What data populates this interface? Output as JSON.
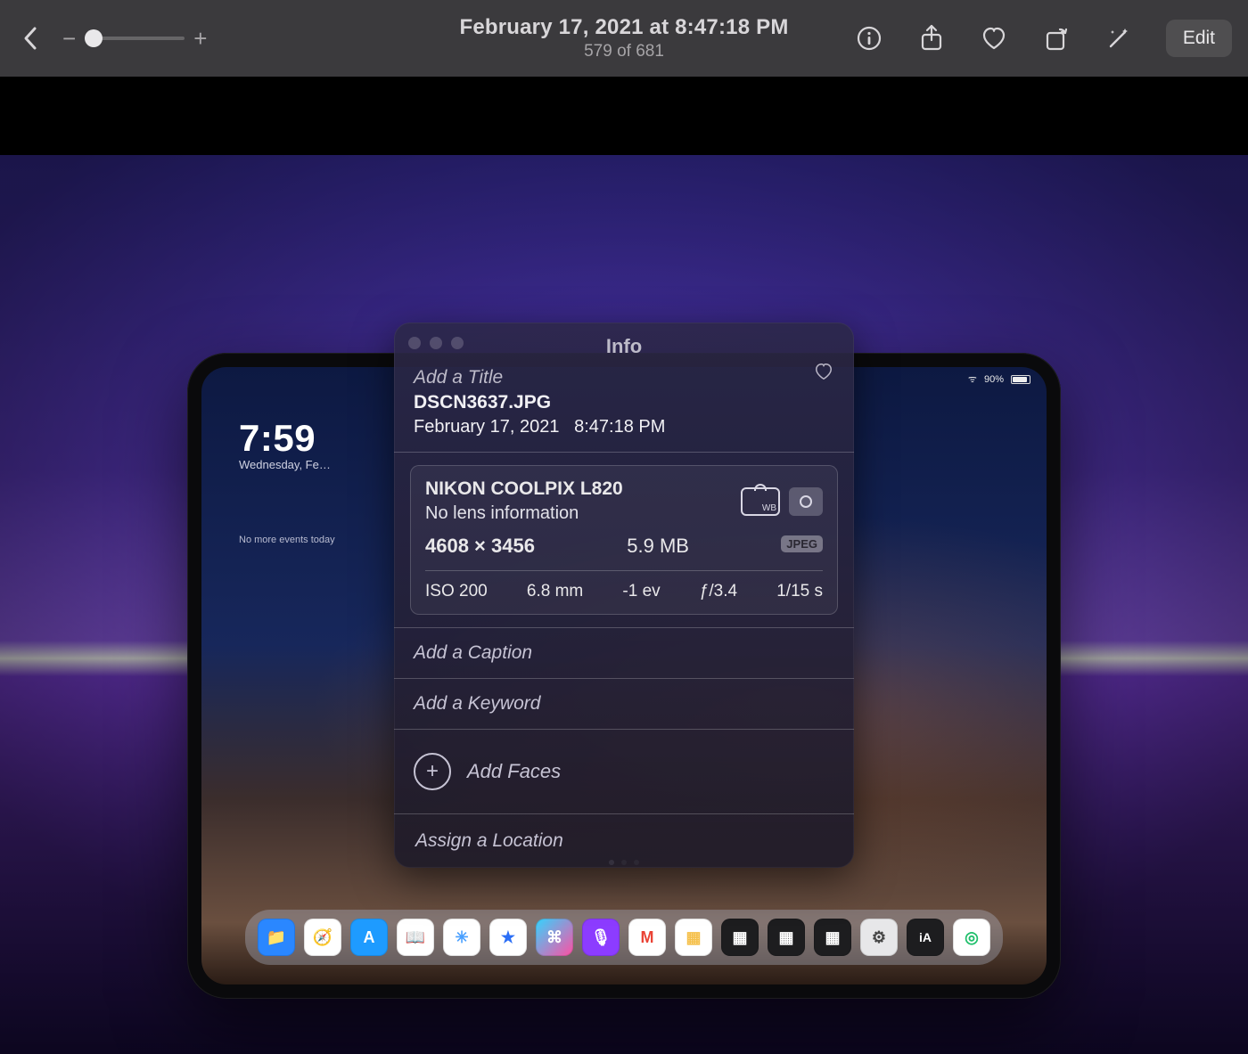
{
  "toolbar": {
    "title": "February 17, 2021 at 8:47:18 PM",
    "sub": "579 of 681",
    "zoom_minus": "−",
    "zoom_plus": "+",
    "edit": "Edit"
  },
  "info": {
    "title": "Info",
    "title_placeholder": "Add a Title",
    "filename": "DSCN3637.JPG",
    "date": "February 17, 2021",
    "time": "8:47:18 PM",
    "camera": "NIKON COOLPIX L820",
    "lens": "No lens information",
    "dims": "4608 × 3456",
    "size": "5.9 MB",
    "format": "JPEG",
    "iso": "ISO 200",
    "focal": "6.8 mm",
    "ev": "-1 ev",
    "aperture": "ƒ/3.4",
    "shutter": "1/15 s",
    "caption_placeholder": "Add a Caption",
    "keyword_placeholder": "Add a Keyword",
    "faces_label": "Add Faces",
    "location_placeholder": "Assign a Location",
    "wb_label": "WB"
  },
  "ipad": {
    "battery": "90%",
    "time": "7:59",
    "date": "Wednesday, Fe…",
    "widget": "No more events today"
  }
}
